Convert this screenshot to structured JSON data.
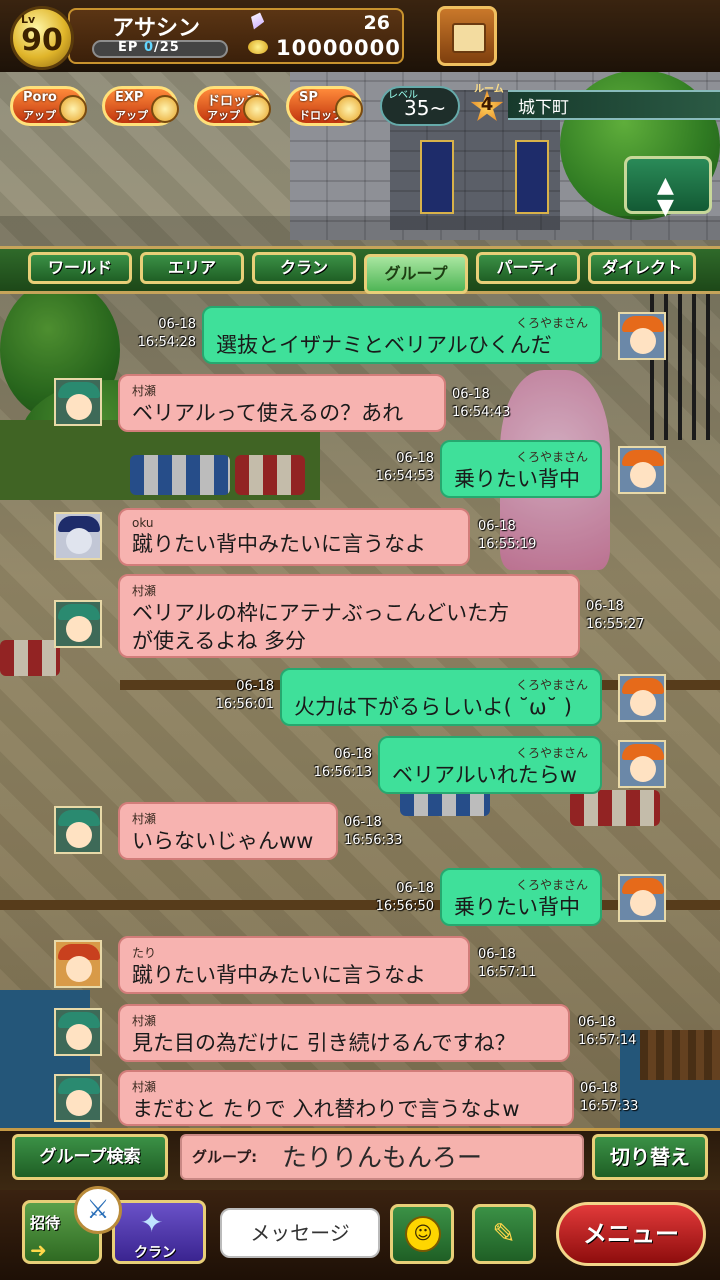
{
  "player": {
    "level_prefix": "Lv",
    "level": "90",
    "name": "アサシン",
    "ep_prefix": "EP",
    "ep_current": "0",
    "ep_max": "/25",
    "gems": "26",
    "gold": "10000000"
  },
  "boosts": [
    {
      "line1": "Poro",
      "line2": "アップ"
    },
    {
      "line1": "EXP",
      "line2": "アップ"
    },
    {
      "line1": "ドロップ",
      "line2": "アップ"
    },
    {
      "line1": "SP",
      "line2": "ドロップ"
    }
  ],
  "area": {
    "level_label": "レベル",
    "level_value": "35~",
    "room_label": "ルーム",
    "room_number": "4",
    "room_name": "城下町"
  },
  "tabs": [
    "ワールド",
    "エリア",
    "クラン",
    "グループ",
    "パーティ",
    "ダイレクト"
  ],
  "active_tab": "グループ",
  "messages": [
    {
      "side": "me",
      "sender": "くろやまさん",
      "date": "06-18",
      "time": "16:54:28",
      "lines": [
        "選抜とイザナミとベリアルひくんだ"
      ]
    },
    {
      "side": "other",
      "sender": "村瀬",
      "date": "06-18",
      "time": "16:54:43",
      "lines": [
        "ベリアルって使えるの？あれ"
      ]
    },
    {
      "side": "me",
      "sender": "くろやまさん",
      "date": "06-18",
      "time": "16:54:53",
      "lines": [
        "乗りたい背中"
      ]
    },
    {
      "side": "other",
      "sender": "oku",
      "date": "06-18",
      "time": "16:55:19",
      "lines": [
        "蹴りたい背中みたいに言うなよ"
      ]
    },
    {
      "side": "other",
      "sender": "村瀬",
      "date": "06-18",
      "time": "16:55:27",
      "lines": [
        "ベリアルの枠にアテナぶっこんどいた方",
        "が使えるよね 多分"
      ]
    },
    {
      "side": "me",
      "sender": "くろやまさん",
      "date": "06-18",
      "time": "16:56:01",
      "lines": [
        "火力は下がるらしいよ( ˘ω˘ )"
      ]
    },
    {
      "side": "me",
      "sender": "くろやまさん",
      "date": "06-18",
      "time": "16:56:13",
      "lines": [
        "ベリアルいれたらw"
      ]
    },
    {
      "side": "other",
      "sender": "村瀬",
      "date": "06-18",
      "time": "16:56:33",
      "lines": [
        "いらないじゃんww"
      ]
    },
    {
      "side": "me",
      "sender": "くろやまさん",
      "date": "06-18",
      "time": "16:56:50",
      "lines": [
        "乗りたい背中"
      ]
    },
    {
      "side": "other",
      "sender": "たり",
      "date": "06-18",
      "time": "16:57:11",
      "lines": [
        "蹴りたい背中みたいに言うなよ"
      ]
    },
    {
      "side": "other",
      "sender": "村瀬",
      "date": "06-18",
      "time": "16:57:14",
      "lines": [
        "見た目の為だけに 引き続けるんですね？"
      ]
    },
    {
      "side": "other",
      "sender": "村瀬",
      "date": "06-18",
      "time": "16:57:33",
      "lines": [
        "まだむと たりで 入れ替わりで言うなよw"
      ]
    }
  ],
  "group_bar": {
    "search_label": "グループ検索",
    "field_label": "グループ:",
    "group_name": "たりりんもんろー",
    "switch_label": "切り替え"
  },
  "bottom_nav": {
    "invite_label": "招待",
    "clan_label": "クラン",
    "message_placeholder": "メッセージ",
    "menu_label": "メニュー"
  },
  "colors": {
    "my_bubble": "#3fe09a",
    "other_bubble": "#f7b3b0",
    "tab_green": "#3b9146",
    "menu_red": "#e23a3a"
  }
}
